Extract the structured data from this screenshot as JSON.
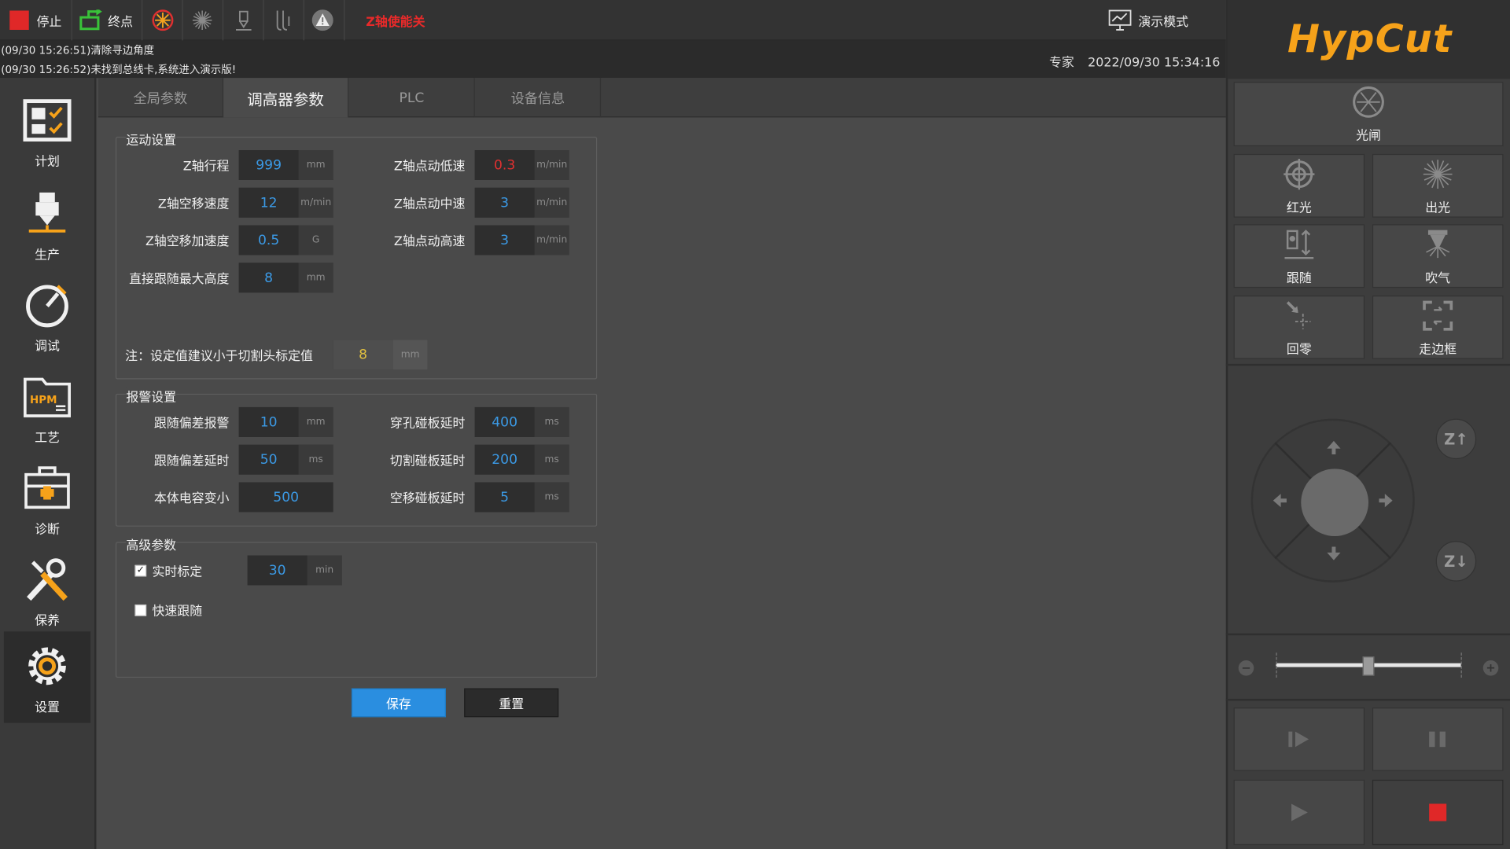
{
  "toolbar": {
    "stop_label": "停止",
    "endpoint_label": "终点",
    "z_enable_label": "Z轴使能关",
    "demo_mode_label": "演示模式"
  },
  "status": {
    "log1": "(09/30 15:26:51)清除寻边角度",
    "log2": "(09/30 15:26:52)未找到总线卡,系统进入演示版!",
    "user_level": "专家",
    "datetime": "2022/09/30 15:34:16"
  },
  "nav": {
    "items": [
      {
        "label": "计划"
      },
      {
        "label": "生产"
      },
      {
        "label": "调试"
      },
      {
        "label": "工艺"
      },
      {
        "label": "诊断"
      },
      {
        "label": "保养"
      },
      {
        "label": "设置"
      }
    ],
    "process_icon_text": "HPM"
  },
  "tabs": [
    "全局参数",
    "调高器参数",
    "PLC",
    "设备信息"
  ],
  "motion": {
    "title": "运动设置",
    "z_travel": {
      "label": "Z轴行程",
      "value": "999",
      "unit": "mm"
    },
    "z_move_speed": {
      "label": "Z轴空移速度",
      "value": "12",
      "unit": "m/min"
    },
    "z_move_accel": {
      "label": "Z轴空移加速度",
      "value": "0.5",
      "unit": "G"
    },
    "max_follow_height": {
      "label": "直接跟随最大高度",
      "value": "8",
      "unit": "mm"
    },
    "z_jog_low": {
      "label": "Z轴点动低速",
      "value": "0.3",
      "unit": "m/min"
    },
    "z_jog_mid": {
      "label": "Z轴点动中速",
      "value": "3",
      "unit": "m/min"
    },
    "z_jog_high": {
      "label": "Z轴点动高速",
      "value": "3",
      "unit": "m/min"
    },
    "note_label": "注：设定值建议小于切割头标定值",
    "note_value": "8",
    "note_unit": "mm"
  },
  "alarm": {
    "title": "报警设置",
    "follow_dev_alarm": {
      "label": "跟随偏差报警",
      "value": "10",
      "unit": "mm"
    },
    "follow_dev_delay": {
      "label": "跟随偏差延时",
      "value": "50",
      "unit": "ms"
    },
    "body_cap_decrease": {
      "label": "本体电容变小",
      "value": "500"
    },
    "pierce_touch_delay": {
      "label": "穿孔碰板延时",
      "value": "400",
      "unit": "ms"
    },
    "cut_touch_delay": {
      "label": "切割碰板延时",
      "value": "200",
      "unit": "ms"
    },
    "move_touch_delay": {
      "label": "空移碰板延时",
      "value": "5",
      "unit": "ms"
    }
  },
  "advanced": {
    "title": "高级参数",
    "realtime_calib": {
      "label": "实时标定",
      "checked": true,
      "value": "30",
      "unit": "min"
    },
    "fast_follow": {
      "label": "快速跟随",
      "checked": false
    }
  },
  "buttons": {
    "save": "保存",
    "reset": "重置"
  },
  "right_panel": {
    "logo": "HypCut",
    "shutter": "光闸",
    "red_light": "红光",
    "emit_light": "出光",
    "follow": "跟随",
    "blow": "吹气",
    "home": "回零",
    "frame": "走边框",
    "z_up": "Z↑",
    "z_down": "Z↓"
  },
  "colors": {
    "accent_blue": "#2a8ee0",
    "value_blue": "#3b9ae6",
    "alert_red": "#e02828",
    "logo_orange": "#f6a21a"
  }
}
